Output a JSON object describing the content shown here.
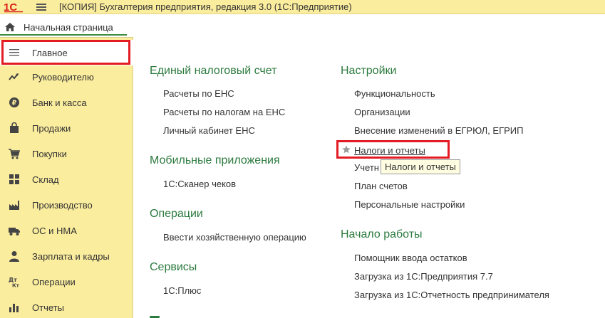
{
  "window": {
    "title": "[КОПИЯ] Бухгалтерия предприятия, редакция 3.0  (1С:Предприятие)",
    "logo_text": "1С"
  },
  "home": {
    "label": "Начальная страница"
  },
  "sidebar": {
    "items": [
      {
        "label": "Главное",
        "icon": "menu-lines-icon"
      },
      {
        "label": "Руководителю",
        "icon": "trend-chart-icon"
      },
      {
        "label": "Банк и касса",
        "icon": "ruble-coin-icon"
      },
      {
        "label": "Продажи",
        "icon": "shopping-bag-icon"
      },
      {
        "label": "Покупки",
        "icon": "shopping-cart-icon"
      },
      {
        "label": "Склад",
        "icon": "warehouse-grid-icon"
      },
      {
        "label": "Производство",
        "icon": "factory-icon"
      },
      {
        "label": "ОС и НМА",
        "icon": "truck-icon"
      },
      {
        "label": "Зарплата и кадры",
        "icon": "person-icon"
      },
      {
        "label": "Операции",
        "icon": "dt-kt-icon"
      },
      {
        "label": "Отчеты",
        "icon": "bar-chart-icon"
      }
    ]
  },
  "main": {
    "sections": [
      {
        "title": "Единый налоговый счет",
        "links": [
          "Расчеты по ЕНС",
          "Расчеты по налогам на ЕНС",
          "Личный кабинет ЕНС"
        ]
      },
      {
        "title": "Мобильные приложения",
        "links": [
          "1С:Сканер чеков"
        ]
      },
      {
        "title": "Операции",
        "links": [
          "Ввести хозяйственную операцию"
        ]
      },
      {
        "title": "Сервисы",
        "links": [
          "1С:Плюс"
        ]
      },
      {
        "title": "Настройки",
        "links": [
          "Функциональность",
          "Организации",
          "Внесение изменений в ЕГРЮЛ, ЕГРИП",
          "Налоги и отчеты",
          "Учетн",
          "План счетов",
          "Персональные настройки"
        ]
      },
      {
        "title": "Начало работы",
        "links": [
          "Помощник ввода остатков",
          "Загрузка из 1С:Предприятия 7.7",
          "Загрузка из 1С:Отчетность предпринимателя"
        ]
      }
    ],
    "tooltip": "Налоги и отчеты"
  },
  "colors": {
    "panel": "#fbed9e",
    "section_title": "#2b7a3e",
    "highlight_box": "#e31c24",
    "home_underline": "#3b8c3b"
  }
}
